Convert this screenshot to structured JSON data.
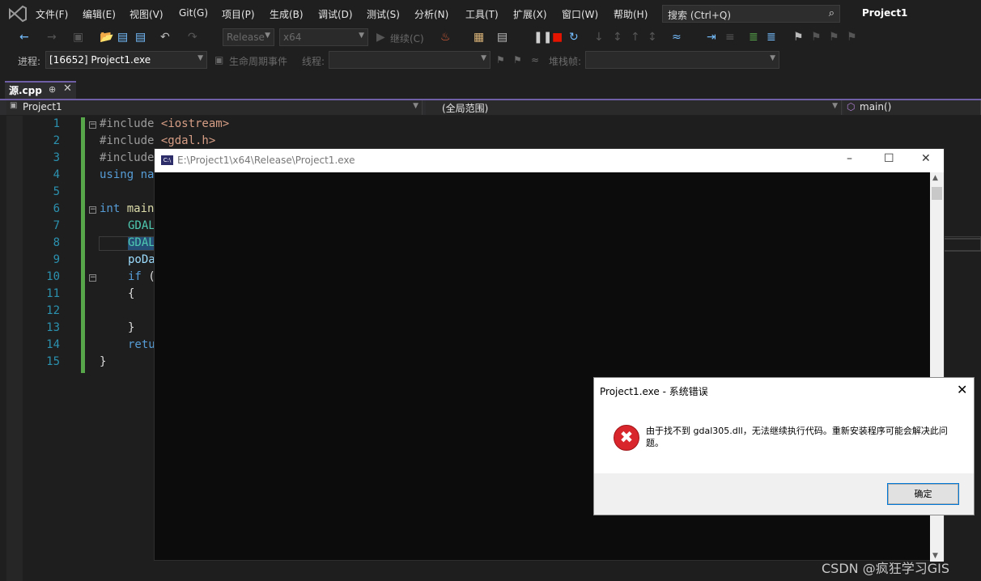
{
  "menubar": {
    "items": [
      "文件(F)",
      "编辑(E)",
      "视图(V)",
      "Git(G)",
      "项目(P)",
      "生成(B)",
      "调试(D)",
      "测试(S)",
      "分析(N)",
      "工具(T)",
      "扩展(X)",
      "窗口(W)",
      "帮助(H)"
    ],
    "search_text": "搜索 (Ctrl+Q)",
    "solution_name": "Project1"
  },
  "toolbar": {
    "configuration": "Release",
    "platform": "x64",
    "continue_label": "继续(C)"
  },
  "debugbar": {
    "process_label": "进程:",
    "process_value": "[16652] Project1.exe",
    "lifecycle_label": "生命周期事件",
    "thread_label": "线程:",
    "stackframe_label": "堆栈帧:"
  },
  "tab": {
    "label": "源.cpp"
  },
  "navbar": {
    "project": "Project1",
    "scope": "(全局范围)",
    "member": "main()"
  },
  "editor": {
    "line_numbers": [
      "1",
      "2",
      "3",
      "4",
      "5",
      "6",
      "7",
      "8",
      "9",
      "10",
      "11",
      "12",
      "13",
      "14",
      "15"
    ],
    "lines": [
      {
        "a": "#include ",
        "b": "<iostream>"
      },
      {
        "a": "#include ",
        "b": "<gdal.h>"
      },
      {
        "a": "#include",
        "b": ""
      },
      {
        "a": "using na",
        "b": ""
      },
      {
        "a": "",
        "b": ""
      },
      {
        "a": "int",
        "b": " main"
      },
      {
        "a": "GDAL",
        "b": ""
      },
      {
        "a": "GDAL",
        "b": ""
      },
      {
        "a": "poDa",
        "b": ""
      },
      {
        "a": "if",
        "b": " ("
      },
      {
        "a": "{",
        "b": ""
      },
      {
        "a": "",
        "b": ""
      },
      {
        "a": "}",
        "b": ""
      },
      {
        "a": "retu",
        "b": ""
      },
      {
        "a": "}",
        "b": ""
      }
    ]
  },
  "console": {
    "title": "E:\\Project1\\x64\\Release\\Project1.exe",
    "icon_text": "C:\\"
  },
  "dialog": {
    "title": "Project1.exe - 系统错误",
    "message": "由于找不到 gdal305.dll，无法继续执行代码。重新安装程序可能会解决此问题。",
    "ok_label": "确定"
  },
  "watermark": "CSDN @疯狂学习GIS",
  "colors": {
    "accent": "#6e5fa6",
    "change_bar": "#57a64a",
    "error_red": "#d9262c"
  }
}
